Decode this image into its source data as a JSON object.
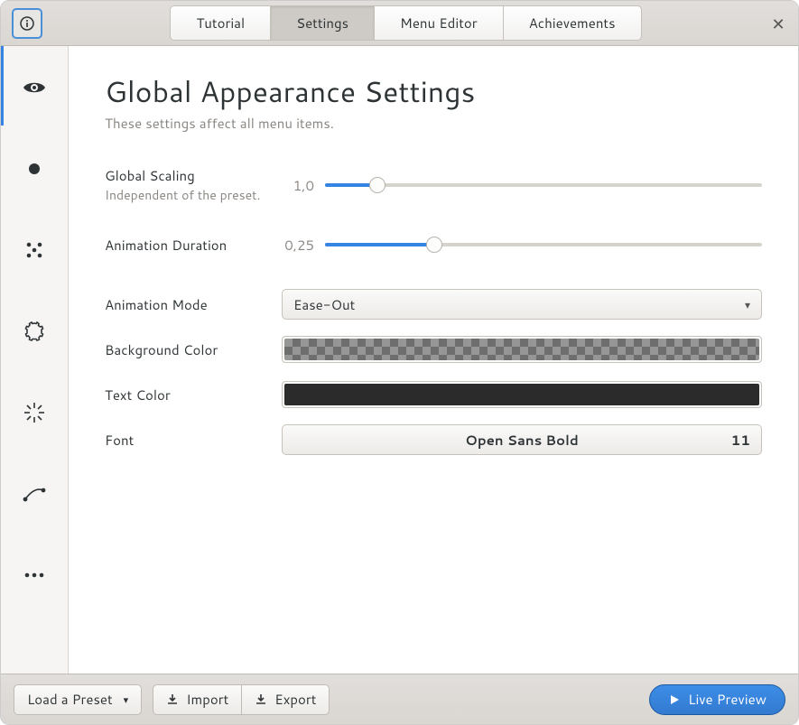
{
  "titlebar": {
    "tabs": [
      "Tutorial",
      "Settings",
      "Menu Editor",
      "Achievements"
    ],
    "active_tab_index": 1
  },
  "sidebar": {
    "items": [
      {
        "icon": "eye-icon",
        "selected": true
      },
      {
        "icon": "circle-icon",
        "selected": false
      },
      {
        "icon": "dots-grid-icon",
        "selected": false
      },
      {
        "icon": "gear-outline-icon",
        "selected": false
      },
      {
        "icon": "sparkle-icon",
        "selected": false
      },
      {
        "icon": "curve-icon",
        "selected": false
      },
      {
        "icon": "ellipsis-icon",
        "selected": false
      }
    ]
  },
  "page": {
    "title": "Global Appearance Settings",
    "subtitle": "These settings affect all menu items."
  },
  "settings": {
    "global_scaling": {
      "label": "Global Scaling",
      "sublabel": "Independent of the preset.",
      "value_text": "1,0",
      "fill_percent": 12
    },
    "animation_duration": {
      "label": "Animation Duration",
      "value_text": "0,25",
      "fill_percent": 25
    },
    "animation_mode": {
      "label": "Animation Mode",
      "value": "Ease-Out"
    },
    "background_color": {
      "label": "Background Color"
    },
    "text_color": {
      "label": "Text Color",
      "value": "#2b2b2b"
    },
    "font": {
      "label": "Font",
      "value": "Open Sans Bold",
      "size": "11"
    }
  },
  "footer": {
    "load_preset": "Load a Preset",
    "import": "Import",
    "export": "Export",
    "live_preview": "Live Preview"
  }
}
